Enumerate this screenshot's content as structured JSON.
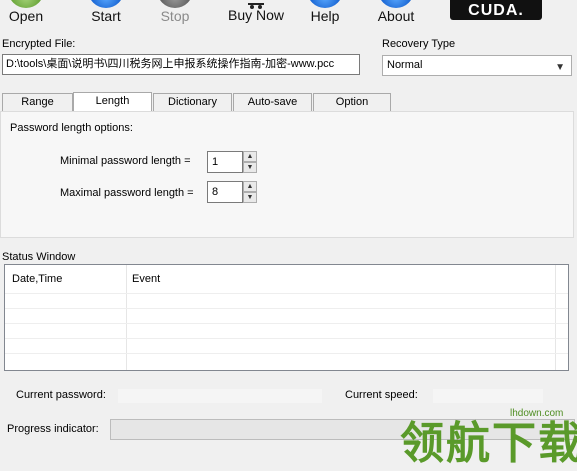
{
  "toolbar": {
    "open": "Open",
    "start": "Start",
    "stop": "Stop",
    "buy_now": "Buy Now",
    "help": "Help",
    "about": "About",
    "badge": "CUDA."
  },
  "encrypted": {
    "label": "Encrypted File:",
    "value": "D:\\tools\\桌面\\说明书\\四川税务网上申报系统操作指南-加密-www.pcc"
  },
  "recovery": {
    "label": "Recovery Type",
    "selected": "Normal"
  },
  "tabs": [
    {
      "label": "Range"
    },
    {
      "label": "Length"
    },
    {
      "label": "Dictionary"
    },
    {
      "label": "Auto-save"
    },
    {
      "label": "Option"
    }
  ],
  "length_panel": {
    "group_title": "Password length options:",
    "min_label": "Minimal password length =",
    "min_value": "1",
    "max_label": "Maximal password length =",
    "max_value": "8"
  },
  "status": {
    "title": "Status Window",
    "columns": [
      "Date,Time",
      "Event"
    ]
  },
  "bottom": {
    "current_password_label": "Current password:",
    "current_speed_label": "Current speed:",
    "progress_label": "Progress indicator:"
  },
  "watermark": {
    "text": "领航下载",
    "url": "lhdown.com"
  },
  "colors": {
    "accent_blue": "#0a55c8",
    "watermark_green": "#5a9a2a"
  }
}
